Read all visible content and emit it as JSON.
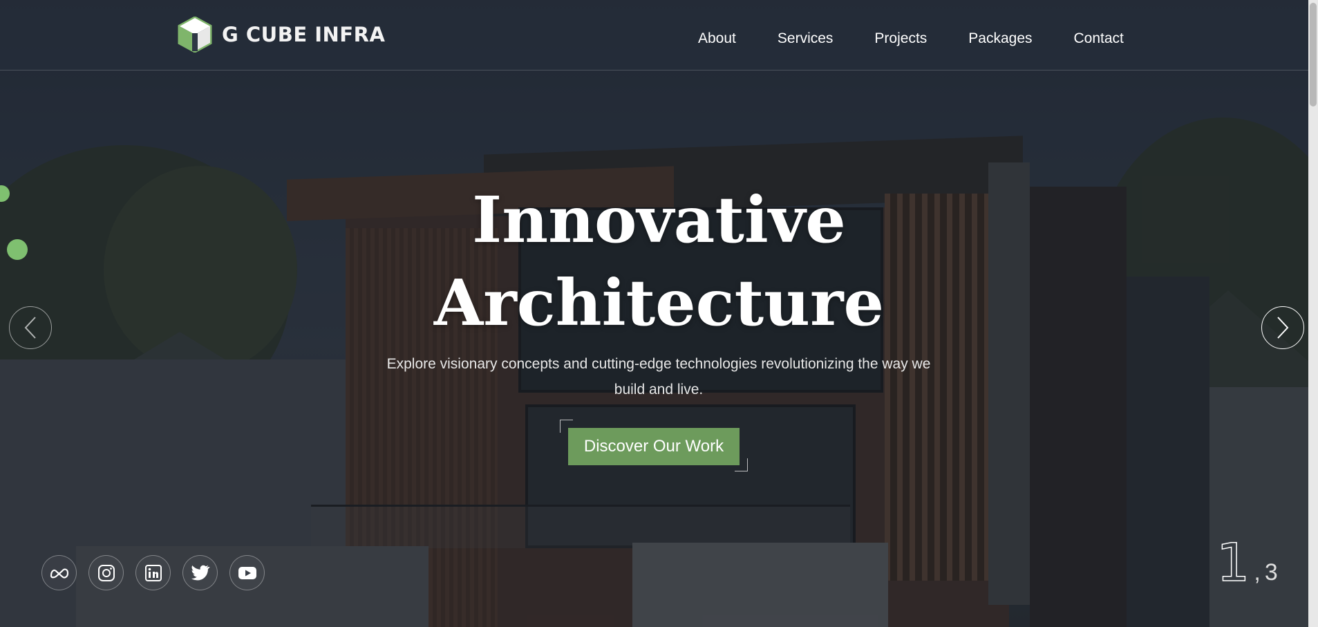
{
  "brand": {
    "name": "G CUBE INFRA",
    "logo_icon": "cube-logo-icon",
    "accent": "#6d9b5c"
  },
  "nav": {
    "items": [
      {
        "label": "About"
      },
      {
        "label": "Services"
      },
      {
        "label": "Projects"
      },
      {
        "label": "Packages"
      },
      {
        "label": "Contact"
      }
    ]
  },
  "hero": {
    "title_line1": "Innovative",
    "title_line2": "Architecture",
    "subtitle": "Explore visionary concepts and cutting-edge technologies revolutionizing the way we build and live.",
    "cta_label": "Discover Our Work",
    "prev_icon": "chevron-left-icon",
    "next_icon": "chevron-right-icon"
  },
  "slider": {
    "current": "1",
    "separator": ",",
    "total": "3"
  },
  "socials": [
    {
      "name": "meta-icon"
    },
    {
      "name": "instagram-icon"
    },
    {
      "name": "linkedin-icon"
    },
    {
      "name": "twitter-icon"
    },
    {
      "name": "youtube-icon"
    }
  ]
}
